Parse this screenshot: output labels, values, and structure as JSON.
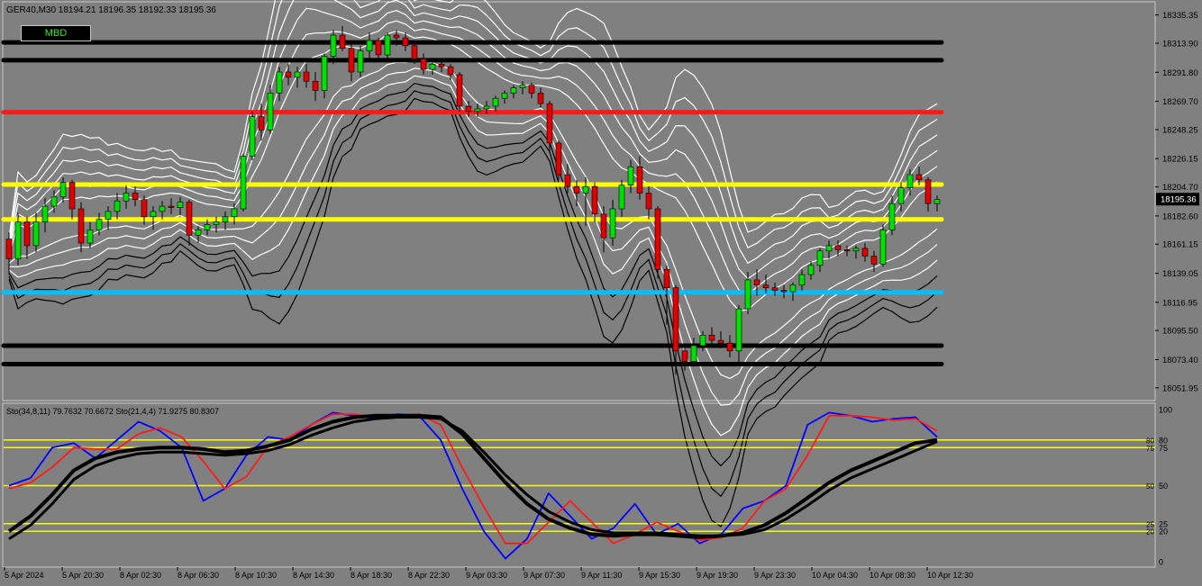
{
  "window": {
    "header": "GER40,M30  18194.21 18196.35 18192.33 18195.36",
    "mbd_label": "MBD"
  },
  "colors": {
    "background": "#808080",
    "bull": "#00e000",
    "bear": "#e00000",
    "band": "#ffffff",
    "resistance_red": "#ff1a1a",
    "yellow": "#ffff00",
    "cyan": "#00bfff",
    "black": "#000000",
    "sto_blue": "#0000ff",
    "sto_red": "#ff0000"
  },
  "chart_data": [
    {
      "type": "candlestick",
      "title": "GER40,M30",
      "symbol": "GER40",
      "timeframe": "M30",
      "last_quote": {
        "open": 18194.21,
        "high": 18196.35,
        "low": 18192.33,
        "close": 18195.36
      },
      "current_price_label": "18195.36",
      "ylim": [
        18045,
        18344
      ],
      "y_ticks": [
        "18335.35",
        "18313.90",
        "18291.80",
        "18269.70",
        "18248.25",
        "18226.15",
        "18204.70",
        "18182.60",
        "18161.15",
        "18139.05",
        "18116.95",
        "18095.50",
        "18073.40",
        "18051.95"
      ],
      "horizontal_levels": [
        {
          "price": 18314.5,
          "color": "black"
        },
        {
          "price": 18301.0,
          "color": "black"
        },
        {
          "price": 18261.5,
          "color": "red"
        },
        {
          "price": 18206.5,
          "color": "yellow"
        },
        {
          "price": 18180.0,
          "color": "yellow"
        },
        {
          "price": 18124.5,
          "color": "cyan"
        },
        {
          "price": 18084.0,
          "color": "black"
        },
        {
          "price": 18070.0,
          "color": "black"
        }
      ],
      "candles": [
        [
          18165,
          18170,
          18138,
          18150
        ],
        [
          18150,
          18185,
          18145,
          18178
        ],
        [
          18178,
          18182,
          18150,
          18160
        ],
        [
          18160,
          18185,
          18155,
          18178
        ],
        [
          18178,
          18196,
          18170,
          18190
        ],
        [
          18190,
          18202,
          18185,
          18197
        ],
        [
          18197,
          18212,
          18193,
          18208
        ],
        [
          18208,
          18210,
          18180,
          18188
        ],
        [
          18188,
          18193,
          18155,
          18162
        ],
        [
          18162,
          18178,
          18158,
          18172
        ],
        [
          18172,
          18185,
          18168,
          18180
        ],
        [
          18180,
          18190,
          18172,
          18186
        ],
        [
          18186,
          18200,
          18180,
          18194
        ],
        [
          18194,
          18206,
          18188,
          18200
        ],
        [
          18200,
          18205,
          18190,
          18195
        ],
        [
          18195,
          18198,
          18176,
          18182
        ],
        [
          18182,
          18190,
          18172,
          18186
        ],
        [
          18186,
          18194,
          18180,
          18190
        ],
        [
          18190,
          18196,
          18184,
          18189
        ],
        [
          18189,
          18197,
          18183,
          18193
        ],
        [
          18193,
          18195,
          18160,
          18168
        ],
        [
          18168,
          18175,
          18162,
          18172
        ],
        [
          18172,
          18180,
          18168,
          18176
        ],
        [
          18176,
          18182,
          18170,
          18178
        ],
        [
          18178,
          18186,
          18172,
          18182
        ],
        [
          18182,
          18192,
          18176,
          18188
        ],
        [
          18188,
          18230,
          18186,
          18228
        ],
        [
          18228,
          18262,
          18225,
          18258
        ],
        [
          18258,
          18268,
          18240,
          18248
        ],
        [
          18248,
          18282,
          18245,
          18276
        ],
        [
          18276,
          18296,
          18270,
          18292
        ],
        [
          18292,
          18298,
          18282,
          18288
        ],
        [
          18288,
          18296,
          18280,
          18292
        ],
        [
          18292,
          18298,
          18280,
          18285
        ],
        [
          18285,
          18292,
          18270,
          18278
        ],
        [
          18278,
          18306,
          18272,
          18304
        ],
        [
          18304,
          18324,
          18298,
          18320
        ],
        [
          18320,
          18327,
          18308,
          18310
        ],
        [
          18310,
          18315,
          18285,
          18292
        ],
        [
          18292,
          18312,
          18288,
          18308
        ],
        [
          18308,
          18322,
          18300,
          18316
        ],
        [
          18316,
          18318,
          18300,
          18305
        ],
        [
          18305,
          18322,
          18302,
          18320
        ],
        [
          18320,
          18324,
          18312,
          18318
        ],
        [
          18318,
          18322,
          18308,
          18312
        ],
        [
          18312,
          18316,
          18298,
          18302
        ],
        [
          18302,
          18306,
          18290,
          18294
        ],
        [
          18294,
          18302,
          18290,
          18298
        ],
        [
          18298,
          18302,
          18292,
          18296
        ],
        [
          18296,
          18298,
          18286,
          18290
        ],
        [
          18290,
          18292,
          18262,
          18266
        ],
        [
          18266,
          18270,
          18258,
          18262
        ],
        [
          18262,
          18268,
          18258,
          18264
        ],
        [
          18264,
          18270,
          18260,
          18266
        ],
        [
          18266,
          18274,
          18262,
          18272
        ],
        [
          18272,
          18278,
          18268,
          18276
        ],
        [
          18276,
          18282,
          18272,
          18280
        ],
        [
          18280,
          18285,
          18275,
          18282
        ],
        [
          18282,
          18284,
          18272,
          18276
        ],
        [
          18276,
          18280,
          18265,
          18268
        ],
        [
          18268,
          18270,
          18232,
          18238
        ],
        [
          18238,
          18240,
          18210,
          18214
        ],
        [
          18214,
          18222,
          18200,
          18205
        ],
        [
          18205,
          18210,
          18190,
          18200
        ],
        [
          18200,
          18212,
          18175,
          18205
        ],
        [
          18205,
          18208,
          18178,
          18184
        ],
        [
          18184,
          18190,
          18155,
          18166
        ],
        [
          18166,
          18195,
          18160,
          18188
        ],
        [
          18188,
          18210,
          18182,
          18206
        ],
        [
          18206,
          18225,
          18200,
          18220
        ],
        [
          18220,
          18228,
          18195,
          18200
        ],
        [
          18200,
          18205,
          18180,
          18188
        ],
        [
          18188,
          18190,
          18135,
          18142
        ],
        [
          18142,
          18145,
          18100,
          18128
        ],
        [
          18128,
          18130,
          18062,
          18080
        ],
        [
          18080,
          18085,
          18065,
          18072
        ],
        [
          18072,
          18090,
          18068,
          18084
        ],
        [
          18084,
          18095,
          18080,
          18092
        ],
        [
          18092,
          18098,
          18084,
          18088
        ],
        [
          18088,
          18095,
          18082,
          18086
        ],
        [
          18086,
          18092,
          18075,
          18080
        ],
        [
          18080,
          18115,
          18070,
          18112
        ],
        [
          18112,
          18140,
          18108,
          18134
        ],
        [
          18134,
          18142,
          18122,
          18130
        ],
        [
          18130,
          18138,
          18124,
          18128
        ],
        [
          18128,
          18132,
          18122,
          18126
        ],
        [
          18126,
          18130,
          18120,
          18125
        ],
        [
          18125,
          18132,
          18118,
          18130
        ],
        [
          18130,
          18142,
          18126,
          18138
        ],
        [
          18138,
          18148,
          18134,
          18145
        ],
        [
          18145,
          18158,
          18140,
          18156
        ],
        [
          18156,
          18164,
          18150,
          18160
        ],
        [
          18160,
          18164,
          18152,
          18157
        ],
        [
          18157,
          18160,
          18152,
          18156
        ],
        [
          18156,
          18160,
          18150,
          18158
        ],
        [
          18158,
          18162,
          18148,
          18152
        ],
        [
          18152,
          18156,
          18140,
          18146
        ],
        [
          18146,
          18176,
          18144,
          18172
        ],
        [
          18172,
          18198,
          18168,
          18192
        ],
        [
          18192,
          18208,
          18186,
          18204
        ],
        [
          18204,
          18218,
          18198,
          18214
        ],
        [
          18214,
          18220,
          18206,
          18210
        ],
        [
          18210,
          18212,
          18186,
          18192
        ],
        [
          18192,
          18198,
          18186,
          18195
        ]
      ]
    },
    {
      "type": "line",
      "title": "Sto(34,8,11) 79.7632 70.6672  Sto(21,4,4) 71.9275 80.8307",
      "ylim": [
        0,
        100
      ],
      "y_ticks": [
        "100",
        "80",
        "75",
        "50",
        "25",
        "20",
        "0"
      ],
      "levels": [
        80,
        75,
        50,
        25,
        20
      ],
      "x_labels": [
        "5 Apr 2024",
        "5 Apr 20:30",
        "8 Apr 02:30",
        "8 Apr 06:30",
        "8 Apr 10:30",
        "8 Apr 14:30",
        "8 Apr 18:30",
        "8 Apr 22:30",
        "9 Apr 03:30",
        "9 Apr 07:30",
        "9 Apr 11:30",
        "9 Apr 15:30",
        "9 Apr 19:30",
        "9 Apr 23:30",
        "10 Apr 04:30",
        "10 Apr 08:30",
        "10 Apr 12:30"
      ],
      "series": [
        {
          "color": "blue",
          "values": [
            50,
            55,
            75,
            78,
            68,
            80,
            92,
            86,
            75,
            40,
            48,
            70,
            82,
            80,
            90,
            98,
            96,
            94,
            97,
            96,
            80,
            48,
            20,
            2,
            15,
            45,
            30,
            15,
            22,
            38,
            18,
            25,
            12,
            18,
            35,
            40,
            50,
            90,
            98,
            96,
            92,
            94,
            95,
            82
          ]
        },
        {
          "color": "red",
          "values": [
            48,
            52,
            62,
            75,
            74,
            74,
            84,
            88,
            82,
            66,
            48,
            56,
            76,
            82,
            90,
            97,
            97,
            95,
            96,
            97,
            90,
            62,
            36,
            12,
            12,
            26,
            40,
            26,
            12,
            18,
            26,
            20,
            14,
            16,
            22,
            40,
            48,
            70,
            96,
            96,
            95,
            93,
            94,
            86
          ]
        },
        {
          "color": "black",
          "values": [
            20,
            30,
            44,
            60,
            68,
            72,
            74,
            75,
            75,
            74,
            72,
            73,
            76,
            80,
            87,
            92,
            95,
            96,
            96,
            96,
            95,
            84,
            68,
            52,
            38,
            28,
            22,
            18,
            17,
            18,
            18,
            17,
            16,
            17,
            19,
            24,
            32,
            42,
            52,
            60,
            66,
            72,
            78,
            80
          ]
        },
        {
          "color": "black",
          "values": [
            15,
            24,
            38,
            54,
            63,
            68,
            71,
            72,
            72,
            71,
            70,
            71,
            73,
            77,
            83,
            88,
            92,
            94,
            95,
            95,
            94,
            86,
            72,
            57,
            44,
            33,
            26,
            21,
            19,
            19,
            19,
            18,
            17,
            17,
            18,
            21,
            28,
            37,
            47,
            55,
            61,
            67,
            73,
            79
          ]
        }
      ]
    }
  ]
}
